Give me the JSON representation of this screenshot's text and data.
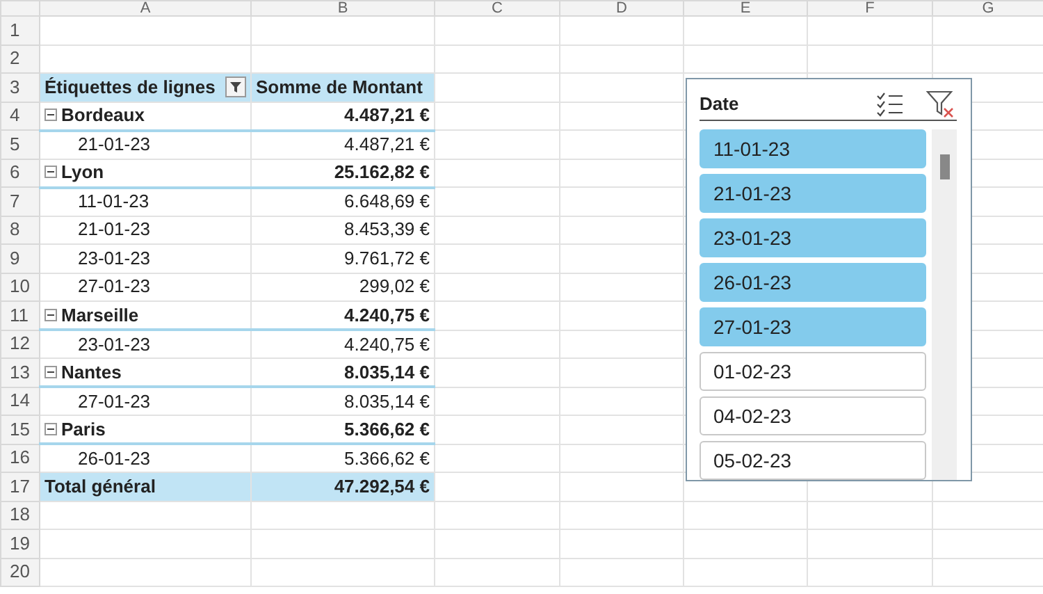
{
  "column_headers": [
    "A",
    "B",
    "C",
    "D",
    "E",
    "F",
    "G"
  ],
  "row_numbers": [
    "1",
    "2",
    "3",
    "4",
    "5",
    "6",
    "7",
    "8",
    "9",
    "10",
    "11",
    "12",
    "13",
    "14",
    "15",
    "16",
    "17",
    "18",
    "19",
    "20"
  ],
  "pivot": {
    "header": {
      "row_labels": "Étiquettes de lignes",
      "value": "Somme de Montant"
    },
    "groups": [
      {
        "label": "Bordeaux",
        "total": "4.487,21 €",
        "expanded": true,
        "children": [
          {
            "label": "21-01-23",
            "value": "4.487,21 €"
          }
        ]
      },
      {
        "label": "Lyon",
        "total": "25.162,82 €",
        "expanded": true,
        "children": [
          {
            "label": "11-01-23",
            "value": "6.648,69 €"
          },
          {
            "label": "21-01-23",
            "value": "8.453,39 €"
          },
          {
            "label": "23-01-23",
            "value": "9.761,72 €"
          },
          {
            "label": "27-01-23",
            "value": "299,02 €"
          }
        ]
      },
      {
        "label": "Marseille",
        "total": "4.240,75 €",
        "expanded": true,
        "children": [
          {
            "label": "23-01-23",
            "value": "4.240,75 €"
          }
        ]
      },
      {
        "label": "Nantes",
        "total": "8.035,14 €",
        "expanded": true,
        "children": [
          {
            "label": "27-01-23",
            "value": "8.035,14 €"
          }
        ]
      },
      {
        "label": "Paris",
        "total": "5.366,62 €",
        "expanded": true,
        "children": [
          {
            "label": "26-01-23",
            "value": "5.366,62 €"
          }
        ]
      }
    ],
    "grand_total": {
      "label": "Total général",
      "value": "47.292,54 €"
    }
  },
  "slicer": {
    "title": "Date",
    "items": [
      {
        "label": "11-01-23",
        "selected": true
      },
      {
        "label": "21-01-23",
        "selected": true
      },
      {
        "label": "23-01-23",
        "selected": true
      },
      {
        "label": "26-01-23",
        "selected": true
      },
      {
        "label": "27-01-23",
        "selected": true
      },
      {
        "label": "01-02-23",
        "selected": false
      },
      {
        "label": "04-02-23",
        "selected": false
      },
      {
        "label": "05-02-23",
        "selected": false
      }
    ]
  }
}
